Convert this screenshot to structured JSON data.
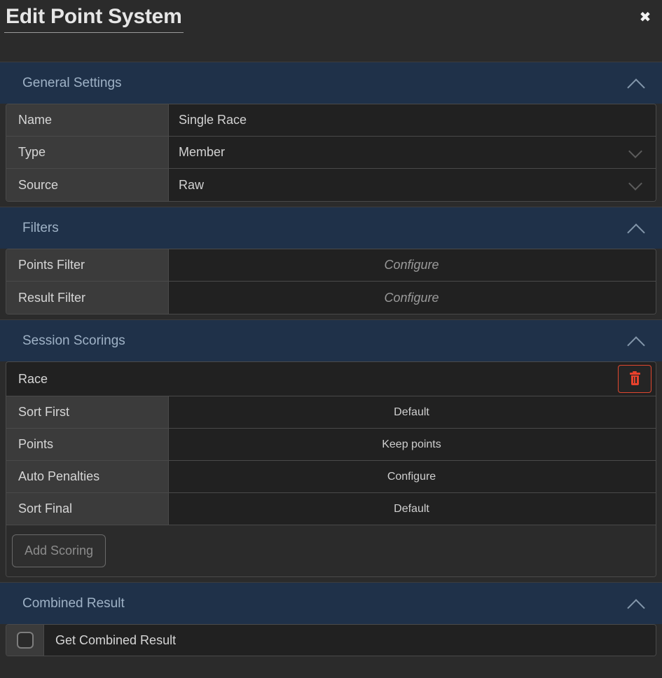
{
  "window": {
    "title": "Edit Point System",
    "close_label": "✖"
  },
  "sections": {
    "general": {
      "title": "General Settings",
      "collapse_icon": "chevron-up-icon",
      "rows": [
        {
          "label": "Name",
          "value": "Single Race",
          "control": "text"
        },
        {
          "label": "Type",
          "value": "Member",
          "control": "select"
        },
        {
          "label": "Source",
          "value": "Raw",
          "control": "select"
        }
      ]
    },
    "filters": {
      "title": "Filters",
      "collapse_icon": "chevron-up-icon",
      "rows": [
        {
          "label": "Points Filter",
          "value": "Configure",
          "control": "link"
        },
        {
          "label": "Result Filter",
          "value": "Configure",
          "control": "link"
        }
      ]
    },
    "session_scorings": {
      "title": "Session Scorings",
      "collapse_icon": "chevron-up-icon",
      "scoring": {
        "name": "Race",
        "delete_icon": "trash-icon",
        "rows": [
          {
            "label": "Sort First",
            "value": "Default"
          },
          {
            "label": "Points",
            "value": "Keep points"
          },
          {
            "label": "Auto Penalties",
            "value": "Configure"
          },
          {
            "label": "Sort Final",
            "value": "Default"
          }
        ]
      },
      "add_label": "Add Scoring"
    },
    "combined": {
      "title": "Combined Result",
      "collapse_icon": "chevron-up-icon",
      "checkbox_checked": false,
      "label": "Get Combined Result"
    }
  },
  "colors": {
    "page_bg": "#2b2b2b",
    "section_header_bg": "#1f3149",
    "section_header_text": "#9fb2c6",
    "label_cell_bg": "#3b3b3b",
    "value_cell_bg": "#212121",
    "border": "#4a4a4a",
    "danger": "#e8412c",
    "text": "#d6d6d6",
    "muted_text": "#9a9a9a"
  }
}
